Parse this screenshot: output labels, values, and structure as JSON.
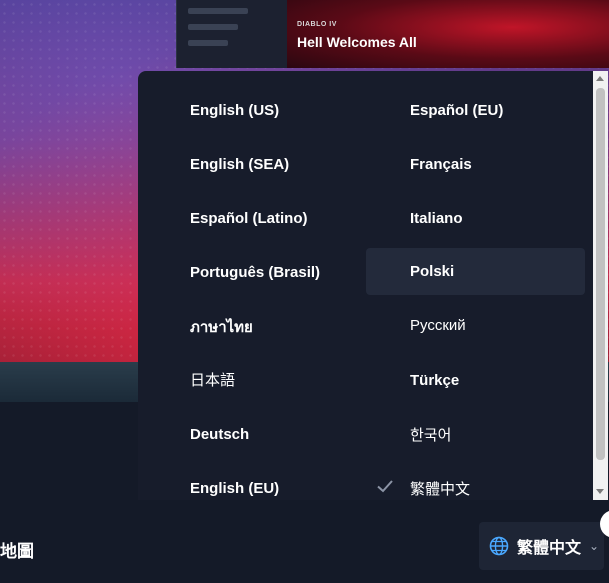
{
  "promo": {
    "kicker": "DIABLO IV",
    "title": "Hell Welcomes All"
  },
  "footer": {
    "left_label": "地圖"
  },
  "language_button": {
    "label": "繁體中文",
    "icon": "globe-icon",
    "chevron_icon": "chevron-down-icon"
  },
  "dropdown": {
    "left": [
      "English (US)",
      "English (SEA)",
      "Español (Latino)",
      "Português (Brasil)",
      "ภาษาไทย",
      "日本語",
      "Deutsch",
      "English (EU)"
    ],
    "right": [
      "Español (EU)",
      "Français",
      "Italiano",
      "Polski",
      "Русский",
      "Türkçe",
      "한국어",
      "繁體中文"
    ],
    "hovered": "Polski",
    "selected": "繁體中文"
  },
  "colors": {
    "panel": "#171c2b",
    "hover": "#232a3b",
    "accent_globe": "#4aa8ff"
  }
}
